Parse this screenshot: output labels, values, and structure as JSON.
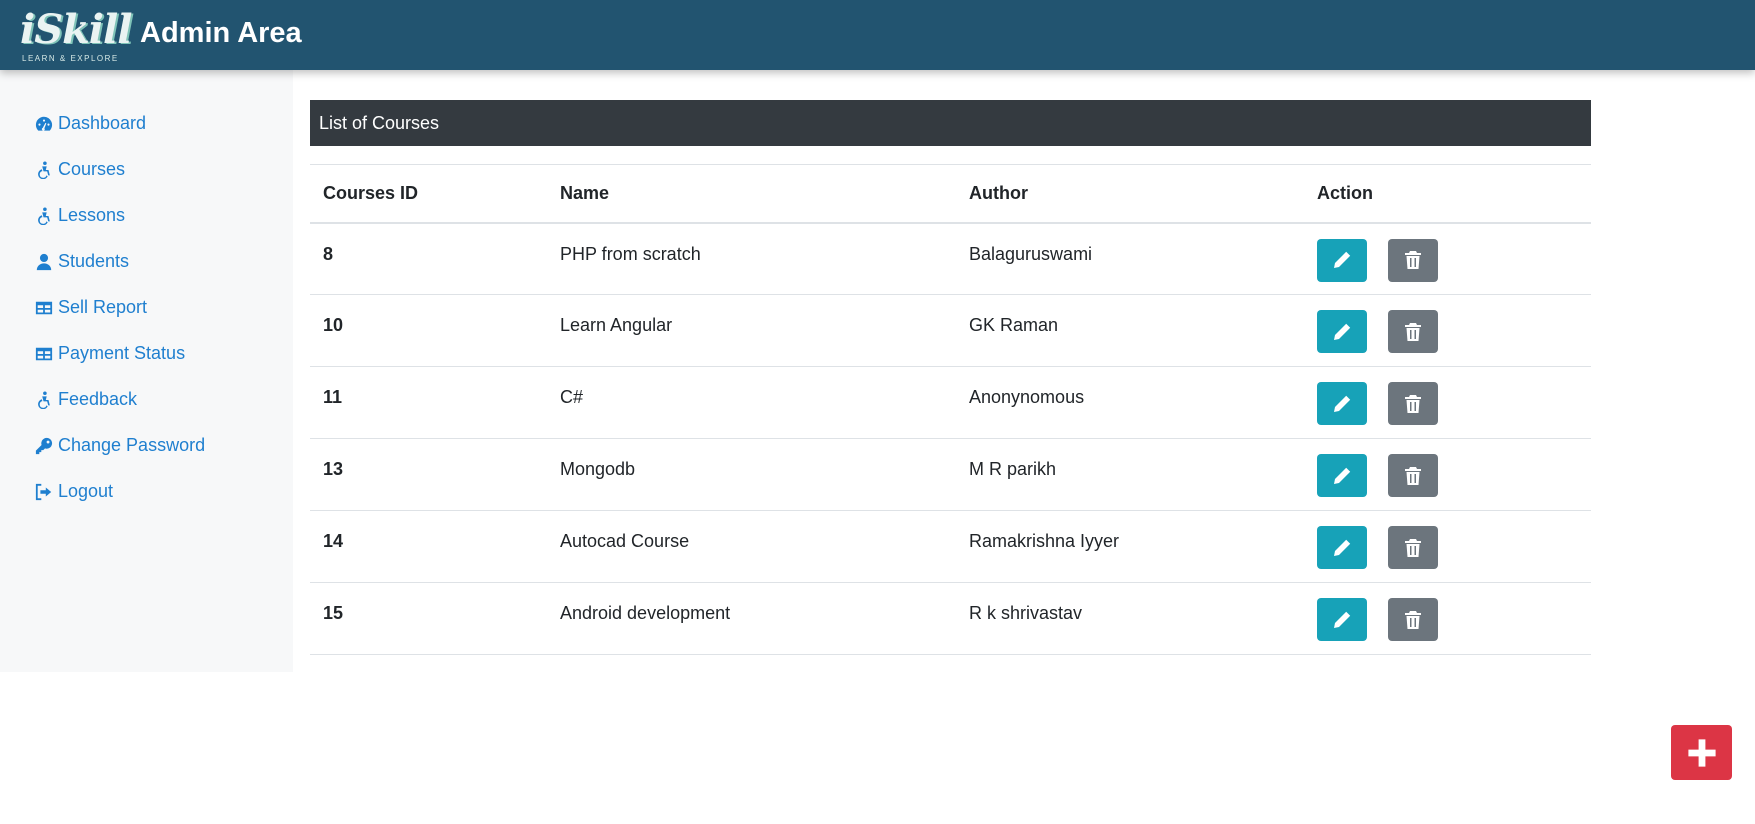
{
  "brand": {
    "logo_text": "iSkill",
    "logo_tagline": "LEARN & EXPLORE",
    "title": "Admin Area"
  },
  "sidebar": {
    "items": [
      {
        "label": "Dashboard",
        "icon": "dashboard-icon"
      },
      {
        "label": "Courses",
        "icon": "accessible-icon"
      },
      {
        "label": "Lessons",
        "icon": "accessible-icon"
      },
      {
        "label": "Students",
        "icon": "user-icon"
      },
      {
        "label": "Sell Report",
        "icon": "table-icon"
      },
      {
        "label": "Payment Status",
        "icon": "table-icon"
      },
      {
        "label": "Feedback",
        "icon": "accessible-icon"
      },
      {
        "label": "Change Password",
        "icon": "key-icon"
      },
      {
        "label": "Logout",
        "icon": "logout-icon"
      }
    ]
  },
  "main": {
    "header": "List of Courses",
    "columns": [
      "Courses ID",
      "Name",
      "Author",
      "Action"
    ],
    "rows": [
      {
        "id": "8",
        "name": "PHP from scratch",
        "author": "Balaguruswami"
      },
      {
        "id": "10",
        "name": "Learn Angular",
        "author": "GK Raman"
      },
      {
        "id": "11",
        "name": "C#",
        "author": "Anonynomous"
      },
      {
        "id": "13",
        "name": "Mongodb",
        "author": "M R parikh"
      },
      {
        "id": "14",
        "name": "Autocad Course",
        "author": "Ramakrishna Iyyer"
      },
      {
        "id": "15",
        "name": "Android development",
        "author": "R k shrivastav"
      }
    ]
  },
  "colors": {
    "topbar": "#225470",
    "link": "#1f7fcf",
    "edit": "#17a2b8",
    "delete": "#6c757d",
    "add": "#dc3545",
    "header_bar": "#343a40"
  }
}
